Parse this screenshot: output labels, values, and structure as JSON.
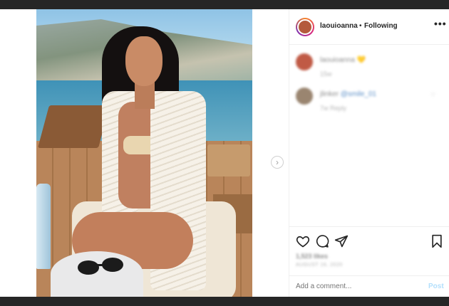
{
  "post": {
    "username": "laouioanna",
    "separator": "•",
    "follow_status": "Following",
    "more_label": "•••"
  },
  "comments": [
    {
      "username": "laouioanna",
      "text": "💛",
      "meta": "15w"
    },
    {
      "username": "jlinker",
      "text": "@smile_01",
      "meta": "7w   Reply"
    }
  ],
  "actions": {
    "likes_text": "1,523 likes",
    "date_text": "AUGUST 16, 2020"
  },
  "comment_box": {
    "placeholder": "Add a comment...",
    "post_label": "Post"
  },
  "navigation": {
    "next_label": "›"
  },
  "colors": {
    "accent": "#0095f6",
    "post_disabled": "#b2dffc",
    "text": "#262626",
    "muted": "#8e8e8e"
  }
}
